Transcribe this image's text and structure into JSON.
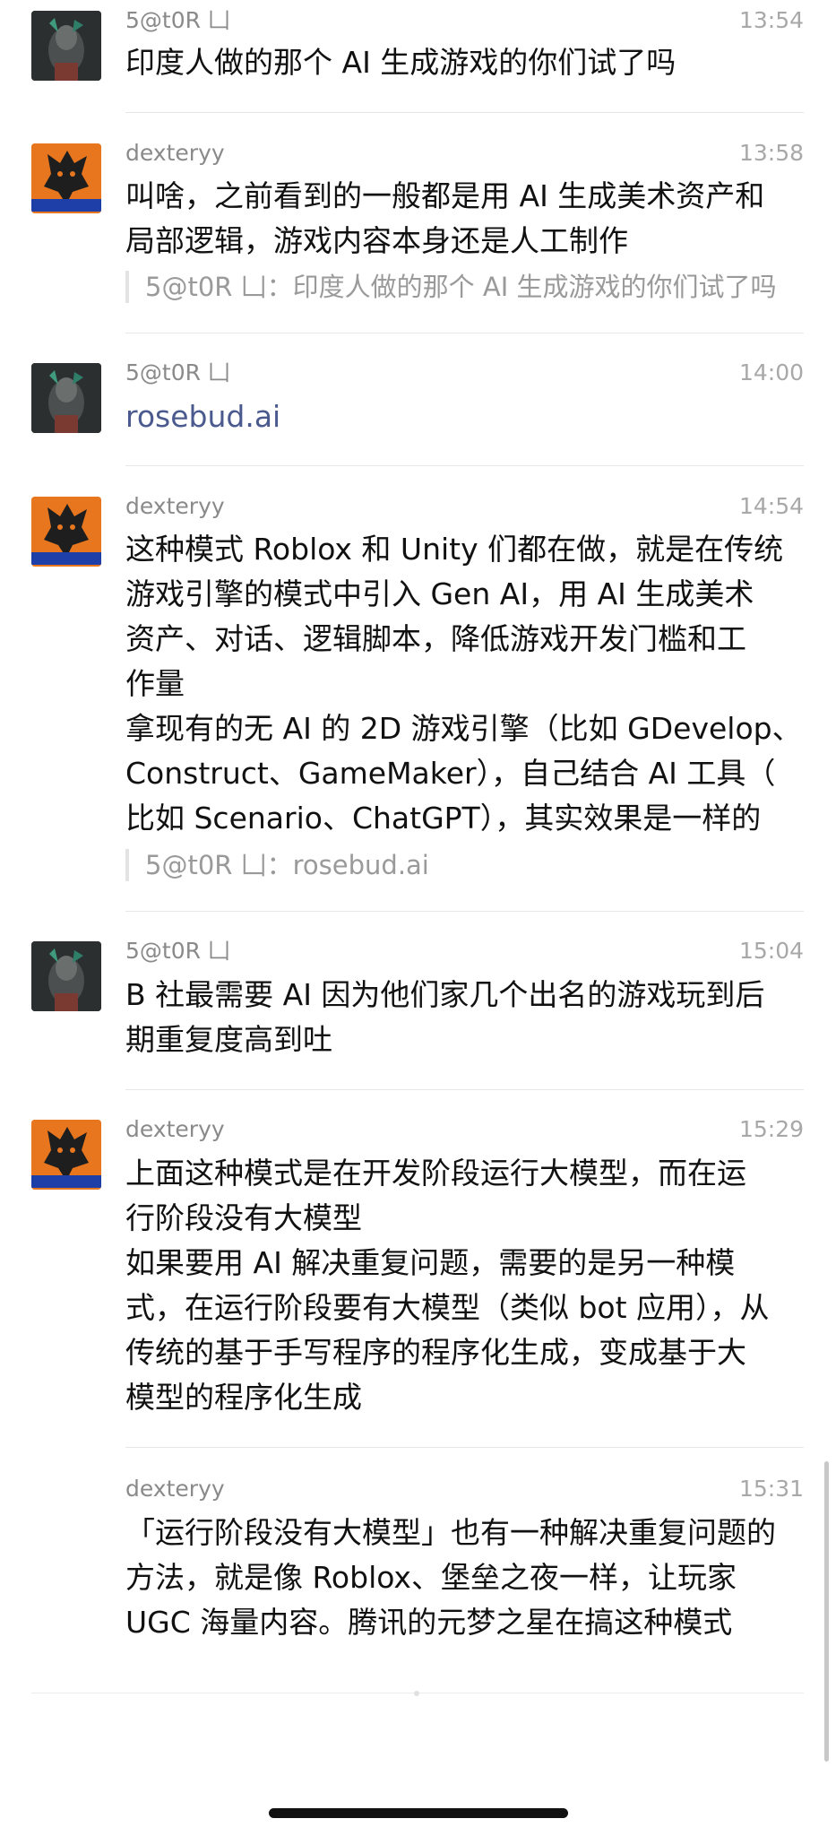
{
  "messages": [
    {
      "sender": "5@t0R 凵",
      "time": "13:54",
      "lines": [
        "印度人做的那个 AI 生成游戏的你们试了吗"
      ]
    },
    {
      "sender": "dexteryy",
      "time": "13:58",
      "lines": [
        "叫啥，之前看到的一般都是用 AI 生成美术资产和",
        "局部逻辑，游戏内容本身还是人工制作"
      ],
      "quote": "5@t0R 凵：印度人做的那个 AI 生成游戏的你们试了吗"
    },
    {
      "sender": "5@t0R 凵",
      "time": "14:00",
      "lines": [
        "rosebud.ai"
      ]
    },
    {
      "sender": "dexteryy",
      "time": "14:54",
      "lines": [
        "这种模式 Roblox 和 Unity 们都在做，就是在传统",
        "游戏引擎的模式中引入 Gen AI，用 AI 生成美术",
        "资产、对话、逻辑脚本，降低游戏开发门槛和工",
        "作量",
        "拿现有的无 AI 的 2D 游戏引擎（比如 GDevelop、",
        "Construct、GameMaker），自己结合 AI 工具（",
        "比如 Scenario、ChatGPT），其实效果是一样的"
      ],
      "quote": "5@t0R 凵：rosebud.ai"
    },
    {
      "sender": "5@t0R 凵",
      "time": "15:04",
      "lines": [
        "B 社最需要 AI 因为他们家几个出名的游戏玩到后",
        "期重复度高到吐"
      ]
    },
    {
      "sender": "dexteryy",
      "time": "15:29",
      "lines": [
        "上面这种模式是在开发阶段运行大模型，而在运",
        "行阶段没有大模型",
        "如果要用 AI 解决重复问题，需要的是另一种模",
        "式，在运行阶段要有大模型（类似 bot 应用），从",
        "传统的基于手写程序的程序化生成，变成基于大",
        "模型的程序化生成"
      ]
    },
    {
      "sender": "dexteryy",
      "time": "15:31",
      "lines": [
        "「运行阶段没有大模型」也有一种解决重复问题的",
        "方法，就是像 Roblox、堡垒之夜一样，让玩家",
        "UGC 海量内容。腾讯的元梦之星在搞这种模式"
      ]
    }
  ]
}
